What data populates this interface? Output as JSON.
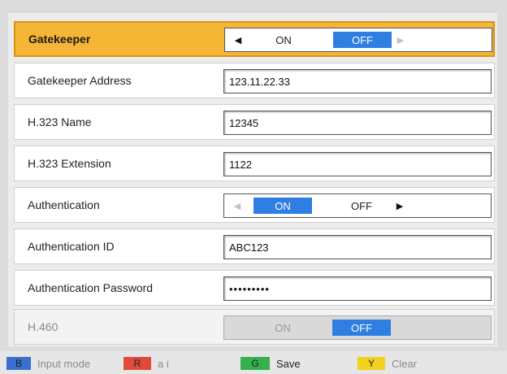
{
  "rows": [
    {
      "label": "Gatekeeper",
      "type": "toggle",
      "on": "ON",
      "off": "OFF",
      "selected": "OFF"
    },
    {
      "label": "Gatekeeper Address",
      "type": "text",
      "value": "123.11.22.33"
    },
    {
      "label": "H.323 Name",
      "type": "text",
      "value": "12345"
    },
    {
      "label": "H.323 Extension",
      "type": "text",
      "value": "1122"
    },
    {
      "label": "Authentication",
      "type": "toggle",
      "on": "ON",
      "off": "OFF",
      "selected": "ON"
    },
    {
      "label": "Authentication ID",
      "type": "text",
      "value": "ABC123"
    },
    {
      "label": "Authentication Password",
      "type": "password",
      "value": "•••••••••"
    },
    {
      "label": "H.460",
      "type": "toggle",
      "on": "ON",
      "off": "OFF",
      "selected": "OFF",
      "disabled": true
    }
  ],
  "footer": {
    "blue_key": "B",
    "blue_text": "Input mode",
    "red_key": "R",
    "red_text": "a i",
    "green_key": "G",
    "green_text": "Save",
    "yellow_key": "Y",
    "yellow_text": "Clear"
  },
  "colors": {
    "highlight": "#f6b635",
    "toggle_active": "#2f7fe3",
    "key_blue": "#3a6fd0",
    "key_red": "#e04a3a",
    "key_green": "#36b04c",
    "key_yellow": "#f1d21f"
  },
  "icons": {
    "left_arrow": "left-triangle-icon",
    "right_arrow": "right-triangle-icon"
  }
}
